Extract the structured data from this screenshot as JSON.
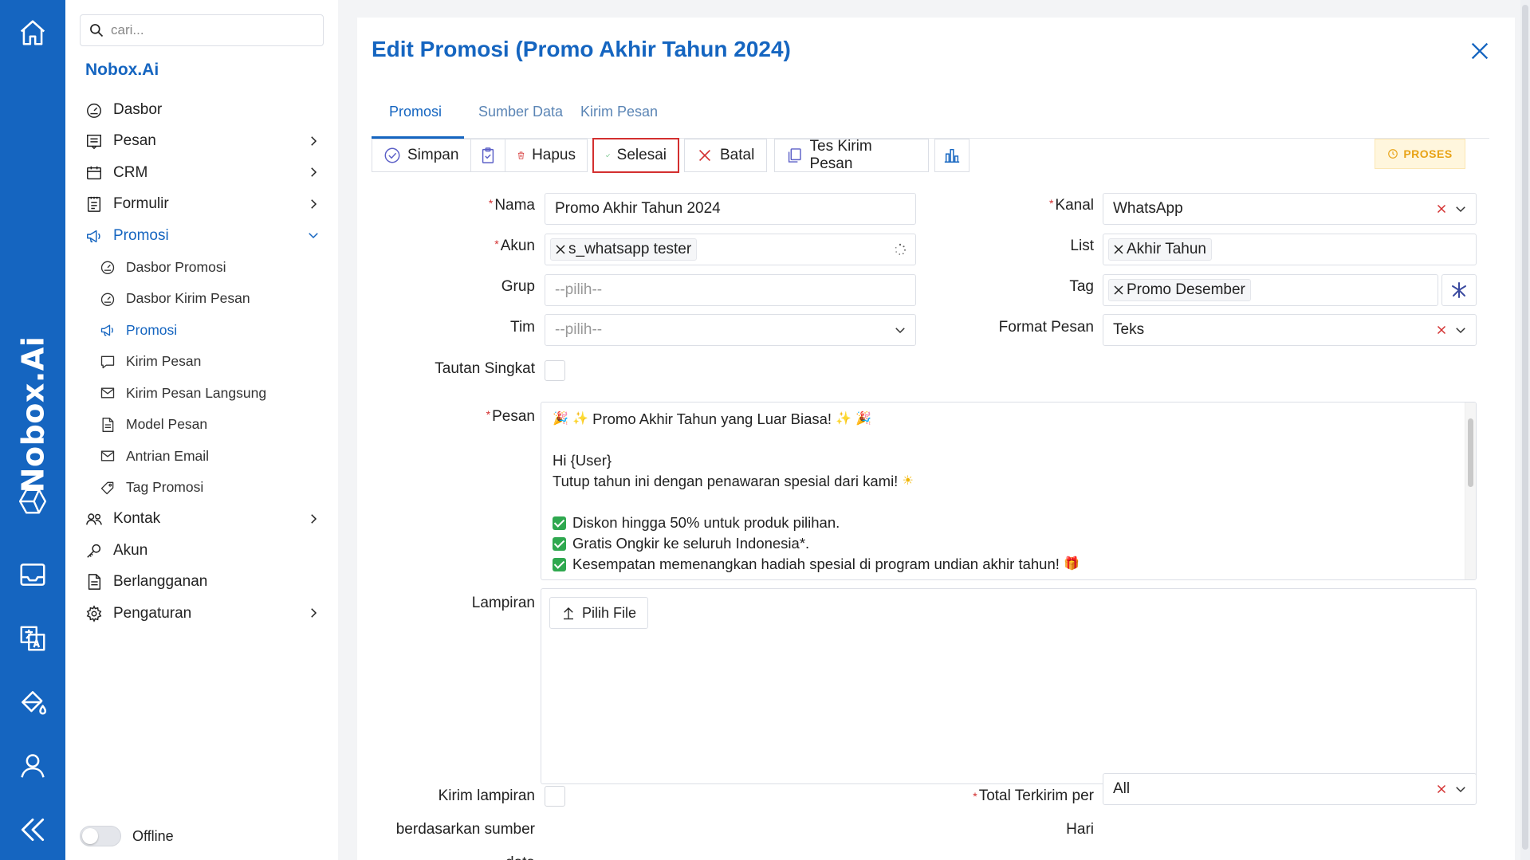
{
  "rail": {
    "brand": "Nobox.Ai",
    "icons": [
      "home-icon",
      "nobox-logo-icon",
      "inbox-icon",
      "translate-icon",
      "paint-bucket-icon",
      "user-icon",
      "collapse-icon"
    ]
  },
  "sidebar": {
    "search_placeholder": "cari...",
    "app_name": "Nobox.Ai",
    "items": [
      {
        "label": "Dasbor",
        "icon": "dashboard-icon"
      },
      {
        "label": "Pesan",
        "icon": "message-icon"
      },
      {
        "label": "CRM",
        "icon": "calendar-icon"
      },
      {
        "label": "Formulir",
        "icon": "form-icon"
      },
      {
        "label": "Promosi",
        "icon": "megaphone-icon"
      },
      {
        "label": "Kontak",
        "icon": "contacts-icon"
      },
      {
        "label": "Akun",
        "icon": "key-icon"
      },
      {
        "label": "Berlangganan",
        "icon": "document-icon"
      },
      {
        "label": "Pengaturan",
        "icon": "settings-icon"
      }
    ],
    "sub_items": [
      {
        "label": "Dasbor Promosi"
      },
      {
        "label": "Dasbor Kirim Pesan"
      },
      {
        "label": "Promosi"
      },
      {
        "label": "Kirim Pesan"
      },
      {
        "label": "Kirim Pesan Langsung"
      },
      {
        "label": "Model Pesan"
      },
      {
        "label": "Antrian Email"
      },
      {
        "label": "Tag Promosi"
      }
    ],
    "status_label": "Offline"
  },
  "panel": {
    "title": "Edit Promosi (Promo Akhir Tahun 2024)",
    "tabs": [
      "Promosi",
      "Sumber Data",
      "Kirim Pesan"
    ],
    "toolbar": {
      "save": "Simpan",
      "delete": "Hapus",
      "done": "Selesai",
      "cancel": "Batal",
      "test_send": "Tes Kirim Pesan"
    },
    "status_badge": "PROSES",
    "labels": {
      "nama": "Nama",
      "akun": "Akun",
      "grup": "Grup",
      "tim": "Tim",
      "tautan": "Tautan Singkat",
      "pesan": "Pesan",
      "lampiran": "Lampiran",
      "kirim_lampiran_1": "Kirim lampiran",
      "kirim_lampiran_2": "berdasarkan sumber",
      "kirim_lampiran_3": "data",
      "kanal": "Kanal",
      "list": "List",
      "tag": "Tag",
      "format": "Format Pesan",
      "total_1": "Total Terkirim per",
      "total_2": "Hari"
    },
    "values": {
      "nama": "Promo Akhir Tahun 2024",
      "akun_chip": "s_whatsapp tester",
      "grup_placeholder": "--pilih--",
      "tim_placeholder": "--pilih--",
      "kanal": "WhatsApp",
      "list_chip": "Akhir Tahun",
      "tag_chip": "Promo Desember",
      "format": "Teks",
      "total": "All"
    },
    "message": {
      "line1": "Promo Akhir Tahun yang Luar Biasa!",
      "line2": "Hi {User}",
      "line3": "Tutup tahun ini dengan penawaran spesial dari kami!",
      "bullet1": "Diskon hingga 50% untuk produk pilihan.",
      "bullet2": "Gratis Ongkir ke seluruh Indonesia*.",
      "bullet3": "Kesempatan memenangkan hadiah spesial di program undian akhir tahun!"
    },
    "attach_button": "Pilih File"
  }
}
